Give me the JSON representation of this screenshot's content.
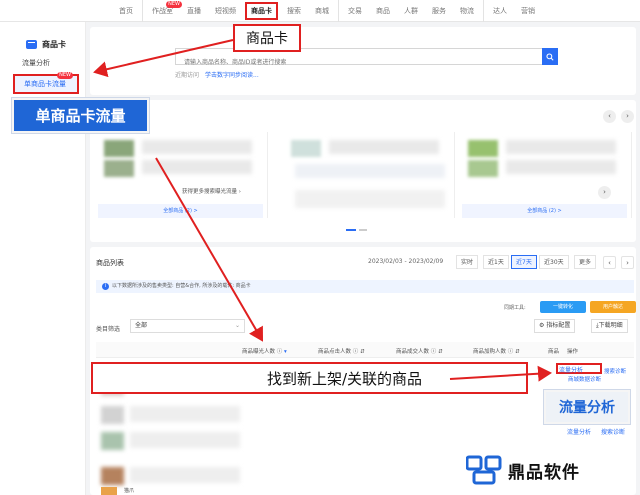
{
  "topnav": {
    "items": [
      {
        "label": "首页",
        "badge": ""
      },
      {
        "label": "作战室",
        "badge": "NEW"
      },
      {
        "label": "直播",
        "badge": ""
      },
      {
        "label": "短视频",
        "badge": ""
      },
      {
        "label": "商品卡",
        "badge": ""
      },
      {
        "label": "搜索",
        "badge": ""
      },
      {
        "label": "商城",
        "badge": ""
      },
      {
        "label": "交易",
        "badge": ""
      },
      {
        "label": "商品",
        "badge": ""
      },
      {
        "label": "人群",
        "badge": ""
      },
      {
        "label": "服务",
        "badge": ""
      },
      {
        "label": "物流",
        "badge": ""
      },
      {
        "label": "达人",
        "badge": ""
      },
      {
        "label": "营销",
        "badge": ""
      }
    ]
  },
  "sidebar": {
    "title": "商品卡",
    "items": [
      {
        "label": "流量分析"
      },
      {
        "label": "单商品卡流量",
        "badge": "NEW"
      }
    ]
  },
  "callouts": {
    "top": "商品卡",
    "left": "单商品卡流量",
    "middle": "找到新上架/关联的商品",
    "right": "流量分析"
  },
  "search": {
    "placeholder": "请输入商品名称、商品ID或者进行搜索",
    "recent_label": "近期访问",
    "recent_link": "学击数字同步阅读..."
  },
  "cards": {
    "first_link": "获得更多搜索曝光流量",
    "first_foot": "全部商品 (2) >",
    "third_foot": "全部商品 (2) >"
  },
  "list": {
    "title": "商品列表",
    "date_range": "2023/02/03 - 2023/02/09",
    "ranges": [
      "实时",
      "近1天",
      "近7天",
      "近30天",
      "更多"
    ],
    "info": "以下数据所涉及的售卖类型: 自营&合作, 所涉及的载体: 商品卡",
    "tools_label": "同期工具:",
    "tool_buttons": [
      "一键转化",
      "用户触达"
    ],
    "filter_label": "类目筛选",
    "filter_value": "全部",
    "config_button": "指标配置",
    "download_button": "下载明细",
    "headers": [
      "商品曝光人数",
      "商品点击人数",
      "商品成交人数",
      "商品加购人数",
      "商品",
      "操作"
    ],
    "op_traffic": "流量分析",
    "op_search": "搜索诊断",
    "op_mall": "商城数据诊断",
    "bottom_item": "猫爪"
  },
  "brand": {
    "name": "鼎品软件"
  },
  "colors": {
    "accent": "#2a6df4",
    "highlight_red": "#e02020",
    "callout_blue": "#1f66d6"
  }
}
